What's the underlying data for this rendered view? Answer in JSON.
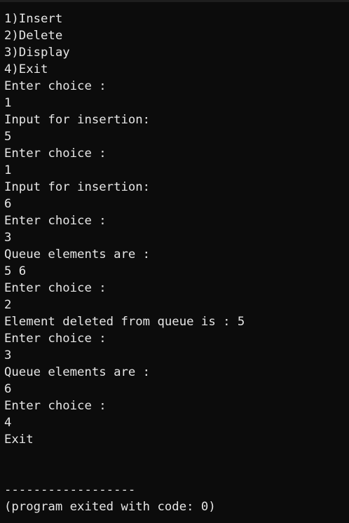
{
  "terminal": {
    "output_lines": [
      "1)Insert",
      "2)Delete",
      "3)Display",
      "4)Exit",
      "Enter choice :",
      "1",
      "Input for insertion:",
      "5",
      "Enter choice :",
      "1",
      "Input for insertion:",
      "6",
      "Enter choice :",
      "3",
      "Queue elements are :",
      "5 6",
      "Enter choice :",
      "2",
      "Element deleted from queue is : 5",
      "Enter choice :",
      "3",
      "Queue elements are :",
      "6",
      "Enter choice :",
      "4",
      "Exit"
    ],
    "separator": "------------------",
    "exit_message": "(program exited with code: 0)"
  },
  "colors": {
    "background": "#0c0c0c",
    "text": "#e6e6e6"
  }
}
